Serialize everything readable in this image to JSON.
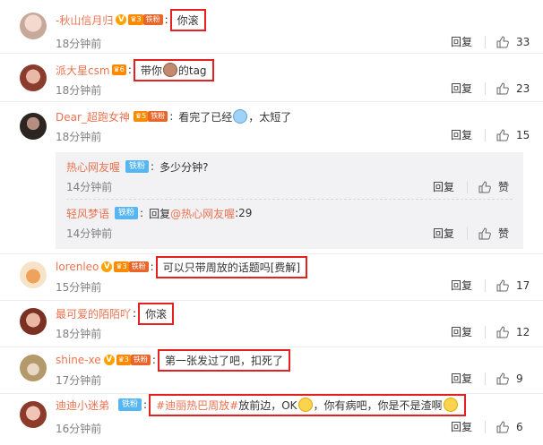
{
  "comments": [
    {
      "name": "-秋山信月归",
      "text": "你滚",
      "time": "18分钟前",
      "reply": "回复",
      "likes": "33"
    },
    {
      "name": "派大星csm",
      "text_before": "带你",
      "text_after": "的tag",
      "time": "18分钟前",
      "reply": "回复",
      "likes": "23"
    },
    {
      "name": "Dear_超跑女神",
      "text_before": "看完了已经",
      "text_after": "，太短了",
      "time": "18分钟前",
      "reply": "回复",
      "likes": "15",
      "replies": [
        {
          "name": "热心网友喔",
          "badge": "铁粉",
          "text": "多少分钟?",
          "time": "14分钟前",
          "reply": "回复",
          "likes": "赞"
        },
        {
          "name": "轻风梦语",
          "badge": "铁粉",
          "reply_prefix": "回复",
          "mention": "@热心网友喔",
          "text": ":29",
          "time": "14分钟前",
          "reply": "回复",
          "likes": "赞"
        }
      ]
    },
    {
      "name": "lorenleo",
      "text": "可以只带周放的话题吗[费解]",
      "time": "15分钟前",
      "reply": "回复",
      "likes": "17"
    },
    {
      "name": "最可爱的陌陌吖",
      "text": "你滚",
      "time": "18分钟前",
      "reply": "回复",
      "likes": "12"
    },
    {
      "name": "shine-xe",
      "text": "第一张发过了吧，扣死了",
      "time": "17分钟前",
      "reply": "回复",
      "likes": "9"
    },
    {
      "name": "迪迪小迷弟",
      "badge": "铁粉",
      "hashtag": "#迪丽热巴周放#",
      "text_mid": " 放前边，OK",
      "text_end": "，你有病吧，你是不是渣啊",
      "time": "16分钟前",
      "reply": "回复",
      "likes": "6"
    }
  ],
  "badges": {
    "fan": "铁粉",
    "v": "V"
  },
  "colors": {
    "username": "#eb7350",
    "highlight_box": "#e52020",
    "time": "#808080",
    "fan_badge": "#e8662b",
    "fan_badge_blue": "#56b6f4",
    "reply_bg": "#f2f2f5"
  },
  "icons": {
    "like": "thumbs-up-icon",
    "verified": "verified-v-icon"
  }
}
